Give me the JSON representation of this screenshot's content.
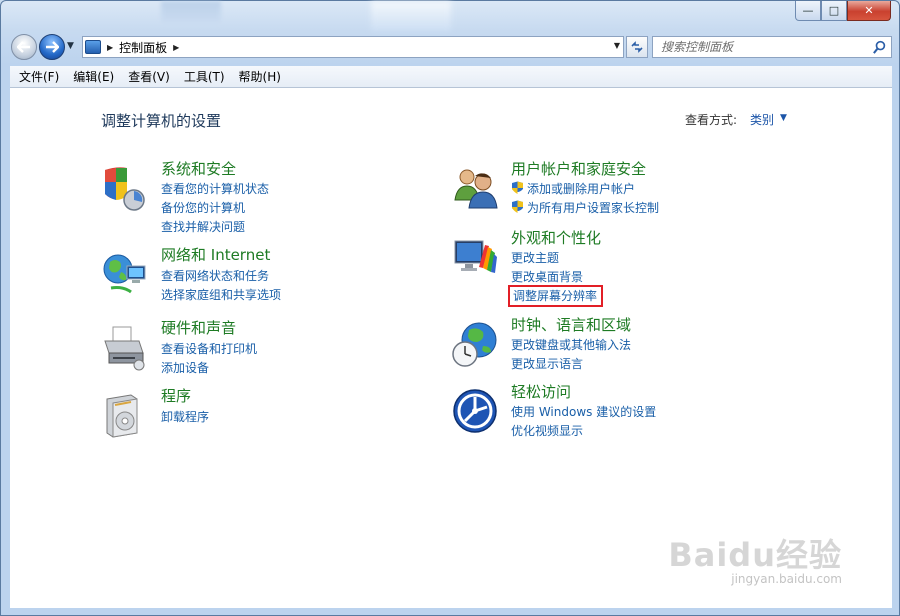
{
  "window": {
    "caption": {
      "minimize": "—",
      "maximize": "□",
      "close": "✕"
    }
  },
  "nav": {
    "breadcrumb": "控制面板",
    "search_placeholder": "搜索控制面板"
  },
  "menu": [
    "文件(F)",
    "编辑(E)",
    "查看(V)",
    "工具(T)",
    "帮助(H)"
  ],
  "content": {
    "title": "调整计算机的设置",
    "view_by_label": "查看方式:",
    "view_by_value": "类别"
  },
  "categories": {
    "system_security": {
      "title": "系统和安全",
      "links": [
        "查看您的计算机状态",
        "备份您的计算机",
        "查找并解决问题"
      ]
    },
    "network": {
      "title": "网络和 Internet",
      "links": [
        "查看网络状态和任务",
        "选择家庭组和共享选项"
      ]
    },
    "hardware": {
      "title": "硬件和声音",
      "links": [
        "查看设备和打印机",
        "添加设备"
      ]
    },
    "programs": {
      "title": "程序",
      "links": [
        "卸载程序"
      ]
    },
    "user_accounts": {
      "title": "用户帐户和家庭安全",
      "links": [
        "添加或删除用户帐户",
        "为所有用户设置家长控制"
      ]
    },
    "appearance": {
      "title": "外观和个性化",
      "links": [
        "更改主题",
        "更改桌面背景",
        "调整屏幕分辨率"
      ]
    },
    "clock_region": {
      "title": "时钟、语言和区域",
      "links": [
        "更改键盘或其他输入法",
        "更改显示语言"
      ]
    },
    "ease_access": {
      "title": "轻松访问",
      "links": [
        "使用 Windows 建议的设置",
        "优化视频显示"
      ]
    }
  },
  "watermark": {
    "logo": "Baidu经验",
    "url": "jingyan.baidu.com"
  },
  "colors": {
    "link": "#1a5fa8",
    "category_title": "#1e7b24",
    "highlight": "#e21f26"
  }
}
